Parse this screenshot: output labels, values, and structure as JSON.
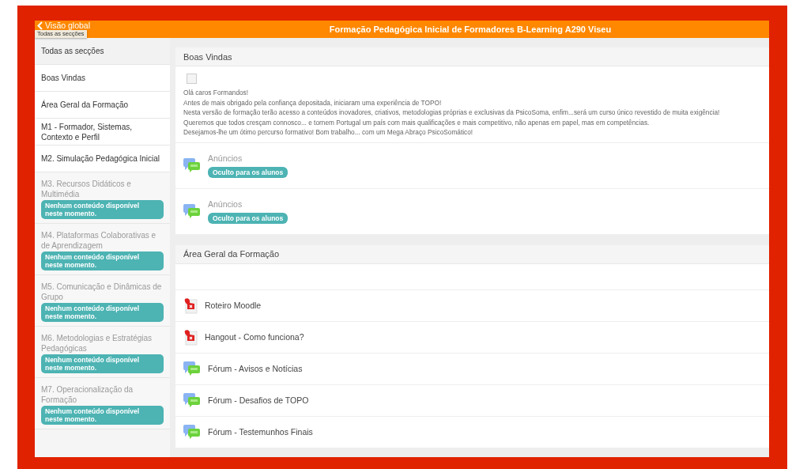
{
  "header": {
    "back_label": "Visão global",
    "tooltip": "Todas as secções",
    "title": "Formação Pedagógica Inicial de Formadores B-Learning A290 Viseu"
  },
  "sidebar": {
    "items": [
      {
        "label": "Todas as secções",
        "disabled": false
      },
      {
        "label": "Boas Vindas",
        "disabled": false
      },
      {
        "label": "Área Geral da Formação",
        "disabled": false
      },
      {
        "label": "M1 - Formador, Sistemas, Contexto e Perfil",
        "disabled": false
      },
      {
        "label": "M2. Simulação Pedagógica Inicial",
        "disabled": false
      },
      {
        "label": "M3. Recursos Didáticos e Multimédia",
        "disabled": true,
        "badge": "Nenhum conteúdo disponível neste momento."
      },
      {
        "label": "M4. Plataformas Colaborativas e de Aprendizagem",
        "disabled": true,
        "badge": "Nenhum conteúdo disponível neste momento."
      },
      {
        "label": "M5. Comunicação e Dinâmicas de Grupo",
        "disabled": true,
        "badge": "Nenhum conteúdo disponível neste momento."
      },
      {
        "label": "M6. Metodologias e Estratégias Pedagógicas",
        "disabled": true,
        "badge": "Nenhum conteúdo disponível neste momento."
      },
      {
        "label": "M7. Operacionalização da Formação",
        "disabled": true,
        "badge": "Nenhum conteúdo disponível neste momento."
      }
    ]
  },
  "sections": [
    {
      "title": "Boas Vindas",
      "items": [
        {
          "kind": "text",
          "lines": [
            "Olá caros Formandos!",
            "Antes de mais obrigado pela confiança depositada, iniciaram uma experiência de TOPO!",
            "Nesta versão de formação terão acesso a conteúdos inovadores, criativos, metodologias próprias e exclusivas da PsicoSoma, enfim...será um curso único revestido de muita exigência!",
            "Queremos que todos cresçam connosco... e tornem Portugal um país com mais qualificações e mais competitivo, não apenas em papel, mas em competências.",
            "Desejamos-lhe um ótimo percurso formativo! Bom trabalho... com um Mega Abraço PsicoSomático!"
          ]
        },
        {
          "kind": "forum",
          "name": "Anúncios",
          "hidden": true,
          "badge": "Oculto para os alunos"
        },
        {
          "kind": "forum",
          "name": "Anúncios",
          "hidden": true,
          "badge": "Oculto para os alunos"
        }
      ]
    },
    {
      "title": "Área Geral da Formação",
      "items": [
        {
          "kind": "blank"
        },
        {
          "kind": "pdf",
          "name": "Roteiro Moodle",
          "hidden": false
        },
        {
          "kind": "pdf",
          "name": "Hangout - Como funciona?",
          "hidden": false
        },
        {
          "kind": "forum",
          "name": "Fórum - Avisos e Notícias",
          "hidden": false
        },
        {
          "kind": "forum",
          "name": "Fórum - Desafios de TOPO",
          "hidden": false
        },
        {
          "kind": "forum",
          "name": "Fórum - Testemunhos Finais",
          "hidden": false
        }
      ]
    }
  ]
}
